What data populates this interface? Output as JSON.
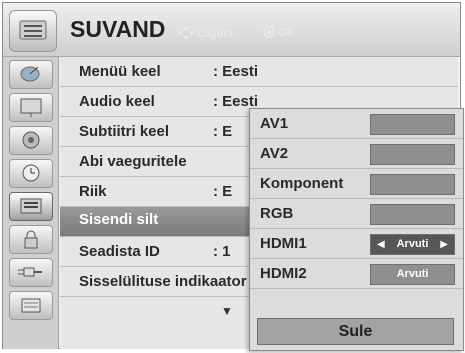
{
  "header": {
    "title": "SUVAND",
    "nav_hint": "Liiguta",
    "ok_hint": "OK"
  },
  "sidebar": {
    "icons": [
      "satellite-dish-icon",
      "tv-monitor-icon",
      "speaker-icon",
      "clock-icon",
      "settings-icon",
      "lock-icon",
      "input-plug-icon",
      "usb-media-icon"
    ],
    "selected_index": 4
  },
  "menu": {
    "rows": [
      {
        "label": "Menüü keel",
        "value": ": Eesti"
      },
      {
        "label": "Audio keel",
        "value": ": Eesti"
      },
      {
        "label": "Subtiitri keel",
        "value": ": E"
      },
      {
        "label": "Abi vaeguritele",
        "value": ""
      },
      {
        "label": "Riik",
        "value": ": E"
      },
      {
        "label": "Sisendi silt",
        "value": ""
      },
      {
        "label": "Seadista ID",
        "value": ": 1"
      },
      {
        "label": "Sisselülituse indikaator",
        "value": ""
      }
    ],
    "selected_row": "Sisendi silt",
    "scroll_down_glyph": "▼"
  },
  "input_label_popup": {
    "items": [
      {
        "label": "AV1",
        "value": ""
      },
      {
        "label": "AV2",
        "value": ""
      },
      {
        "label": "Komponent",
        "value": ""
      },
      {
        "label": "RGB",
        "value": ""
      },
      {
        "label": "HDMI1",
        "value": "Arvuti",
        "selected": true
      },
      {
        "label": "HDMI2",
        "value": "Arvuti"
      }
    ],
    "close_label": "Sule"
  },
  "arrows": {
    "left": "◀",
    "right": "▶"
  }
}
